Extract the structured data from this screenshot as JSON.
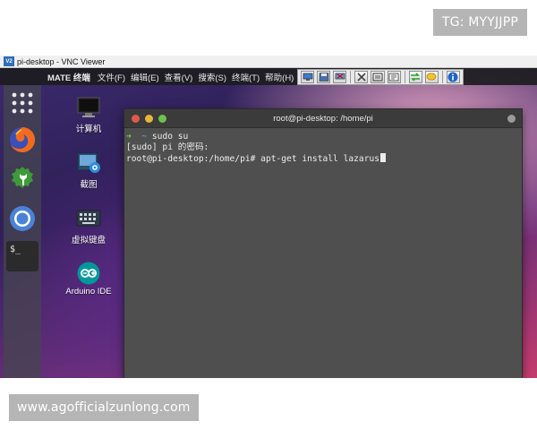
{
  "watermarks": {
    "top": "TG: MYYJJPP",
    "bottom": "www.agofficialzunlong.com"
  },
  "vnc": {
    "title": "pi-desktop - VNC Viewer",
    "logo_text": "V2"
  },
  "panel": {
    "app_menu": "MATE 终端",
    "menus": [
      "文件(F)",
      "编辑(E)",
      "查看(V)",
      "搜索(S)",
      "终端(T)",
      "帮助(H)"
    ]
  },
  "desktop_icons": [
    {
      "label": "计算机",
      "icon": "computer-icon"
    },
    {
      "label": "截图",
      "icon": "screenshot-icon"
    },
    {
      "label": "虚拟键盘",
      "icon": "keyboard-icon"
    },
    {
      "label": "Arduino IDE",
      "icon": "arduino-icon"
    }
  ],
  "dock": {
    "terminal_label": "$_"
  },
  "terminal": {
    "title": "root@pi-desktop: /home/pi",
    "line1_arrow": "➜",
    "line1_tilde": "~",
    "line1_cmd": "sudo su",
    "line2": "[sudo] pi 的密码:",
    "line3": "root@pi-desktop:/home/pi# apt-get install lazarus"
  },
  "colors": {
    "prompt_green": "#7bd14e",
    "tilde_blue": "#6aa2e0",
    "close_red": "#e0584b",
    "min_yellow": "#e7b53a",
    "max_green": "#6cc24a"
  }
}
